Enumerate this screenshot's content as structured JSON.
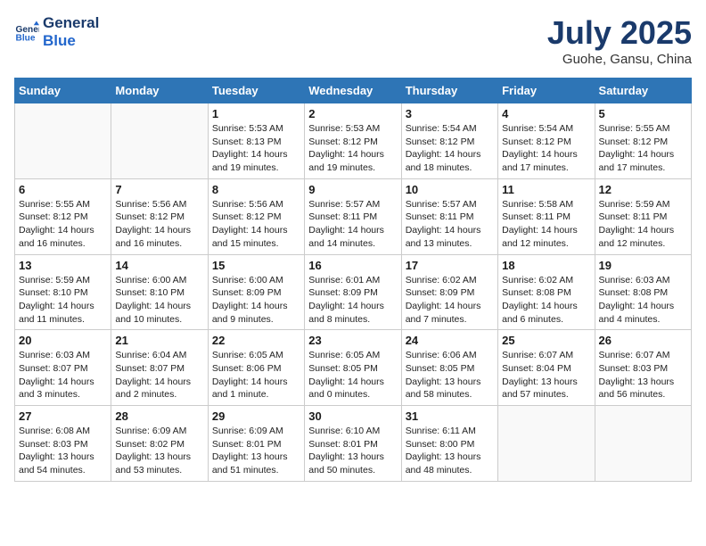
{
  "logo": {
    "line1": "General",
    "line2": "Blue"
  },
  "title": "July 2025",
  "location": "Guohe, Gansu, China",
  "weekdays": [
    "Sunday",
    "Monday",
    "Tuesday",
    "Wednesday",
    "Thursday",
    "Friday",
    "Saturday"
  ],
  "weeks": [
    [
      {
        "day": "",
        "info": ""
      },
      {
        "day": "",
        "info": ""
      },
      {
        "day": "1",
        "info": "Sunrise: 5:53 AM\nSunset: 8:13 PM\nDaylight: 14 hours and 19 minutes."
      },
      {
        "day": "2",
        "info": "Sunrise: 5:53 AM\nSunset: 8:12 PM\nDaylight: 14 hours and 19 minutes."
      },
      {
        "day": "3",
        "info": "Sunrise: 5:54 AM\nSunset: 8:12 PM\nDaylight: 14 hours and 18 minutes."
      },
      {
        "day": "4",
        "info": "Sunrise: 5:54 AM\nSunset: 8:12 PM\nDaylight: 14 hours and 17 minutes."
      },
      {
        "day": "5",
        "info": "Sunrise: 5:55 AM\nSunset: 8:12 PM\nDaylight: 14 hours and 17 minutes."
      }
    ],
    [
      {
        "day": "6",
        "info": "Sunrise: 5:55 AM\nSunset: 8:12 PM\nDaylight: 14 hours and 16 minutes."
      },
      {
        "day": "7",
        "info": "Sunrise: 5:56 AM\nSunset: 8:12 PM\nDaylight: 14 hours and 16 minutes."
      },
      {
        "day": "8",
        "info": "Sunrise: 5:56 AM\nSunset: 8:12 PM\nDaylight: 14 hours and 15 minutes."
      },
      {
        "day": "9",
        "info": "Sunrise: 5:57 AM\nSunset: 8:11 PM\nDaylight: 14 hours and 14 minutes."
      },
      {
        "day": "10",
        "info": "Sunrise: 5:57 AM\nSunset: 8:11 PM\nDaylight: 14 hours and 13 minutes."
      },
      {
        "day": "11",
        "info": "Sunrise: 5:58 AM\nSunset: 8:11 PM\nDaylight: 14 hours and 12 minutes."
      },
      {
        "day": "12",
        "info": "Sunrise: 5:59 AM\nSunset: 8:11 PM\nDaylight: 14 hours and 12 minutes."
      }
    ],
    [
      {
        "day": "13",
        "info": "Sunrise: 5:59 AM\nSunset: 8:10 PM\nDaylight: 14 hours and 11 minutes."
      },
      {
        "day": "14",
        "info": "Sunrise: 6:00 AM\nSunset: 8:10 PM\nDaylight: 14 hours and 10 minutes."
      },
      {
        "day": "15",
        "info": "Sunrise: 6:00 AM\nSunset: 8:09 PM\nDaylight: 14 hours and 9 minutes."
      },
      {
        "day": "16",
        "info": "Sunrise: 6:01 AM\nSunset: 8:09 PM\nDaylight: 14 hours and 8 minutes."
      },
      {
        "day": "17",
        "info": "Sunrise: 6:02 AM\nSunset: 8:09 PM\nDaylight: 14 hours and 7 minutes."
      },
      {
        "day": "18",
        "info": "Sunrise: 6:02 AM\nSunset: 8:08 PM\nDaylight: 14 hours and 6 minutes."
      },
      {
        "day": "19",
        "info": "Sunrise: 6:03 AM\nSunset: 8:08 PM\nDaylight: 14 hours and 4 minutes."
      }
    ],
    [
      {
        "day": "20",
        "info": "Sunrise: 6:03 AM\nSunset: 8:07 PM\nDaylight: 14 hours and 3 minutes."
      },
      {
        "day": "21",
        "info": "Sunrise: 6:04 AM\nSunset: 8:07 PM\nDaylight: 14 hours and 2 minutes."
      },
      {
        "day": "22",
        "info": "Sunrise: 6:05 AM\nSunset: 8:06 PM\nDaylight: 14 hours and 1 minute."
      },
      {
        "day": "23",
        "info": "Sunrise: 6:05 AM\nSunset: 8:05 PM\nDaylight: 14 hours and 0 minutes."
      },
      {
        "day": "24",
        "info": "Sunrise: 6:06 AM\nSunset: 8:05 PM\nDaylight: 13 hours and 58 minutes."
      },
      {
        "day": "25",
        "info": "Sunrise: 6:07 AM\nSunset: 8:04 PM\nDaylight: 13 hours and 57 minutes."
      },
      {
        "day": "26",
        "info": "Sunrise: 6:07 AM\nSunset: 8:03 PM\nDaylight: 13 hours and 56 minutes."
      }
    ],
    [
      {
        "day": "27",
        "info": "Sunrise: 6:08 AM\nSunset: 8:03 PM\nDaylight: 13 hours and 54 minutes."
      },
      {
        "day": "28",
        "info": "Sunrise: 6:09 AM\nSunset: 8:02 PM\nDaylight: 13 hours and 53 minutes."
      },
      {
        "day": "29",
        "info": "Sunrise: 6:09 AM\nSunset: 8:01 PM\nDaylight: 13 hours and 51 minutes."
      },
      {
        "day": "30",
        "info": "Sunrise: 6:10 AM\nSunset: 8:01 PM\nDaylight: 13 hours and 50 minutes."
      },
      {
        "day": "31",
        "info": "Sunrise: 6:11 AM\nSunset: 8:00 PM\nDaylight: 13 hours and 48 minutes."
      },
      {
        "day": "",
        "info": ""
      },
      {
        "day": "",
        "info": ""
      }
    ]
  ]
}
